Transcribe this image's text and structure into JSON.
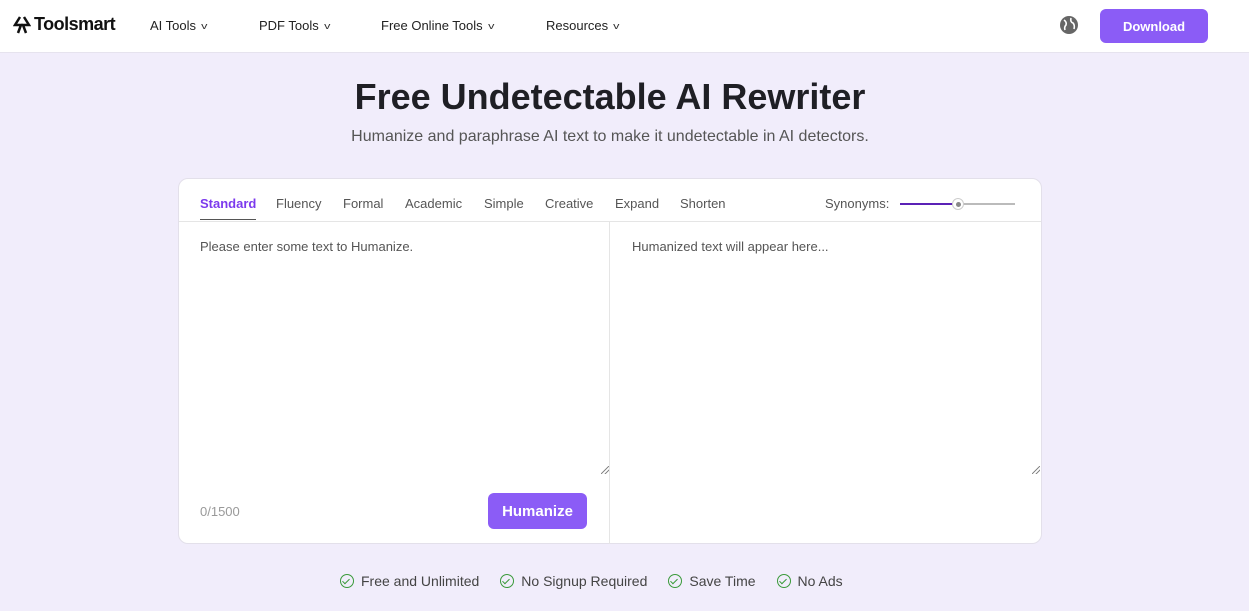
{
  "nav": {
    "brand": "Toolsmart",
    "items": [
      "AI Tools",
      "PDF Tools",
      "Free Online Tools",
      "Resources"
    ],
    "download": "Download"
  },
  "hero": {
    "title": "Free Undetectable AI Rewriter",
    "subtitle": "Humanize and paraphrase AI text to make it undetectable in AI detectors."
  },
  "tool": {
    "tabs": [
      "Standard",
      "Fluency",
      "Formal",
      "Academic",
      "Simple",
      "Creative",
      "Expand",
      "Shorten"
    ],
    "active_tab": "Standard",
    "synonyms_label": "Synonyms:",
    "synonyms_level": 0.5,
    "input_placeholder": "Please enter some text to Humanize.",
    "output_placeholder": "Humanized text will appear here...",
    "count": "0/1500",
    "humanize": "Humanize"
  },
  "features": [
    "Free and Unlimited",
    "No Signup Required",
    "Save Time",
    "No Ads"
  ],
  "colors": {
    "accent": "#8b5cf6",
    "check": "#3a9a3a"
  }
}
